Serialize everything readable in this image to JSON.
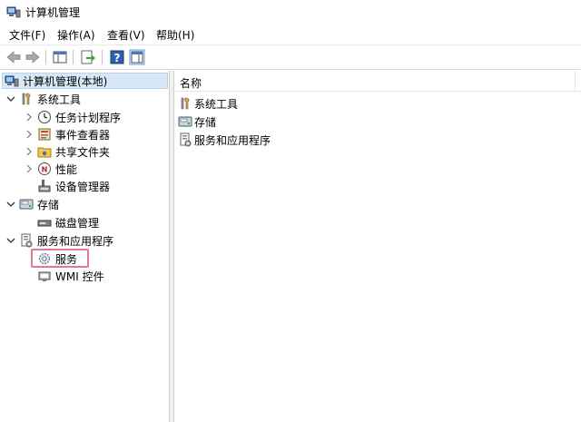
{
  "window": {
    "title": "计算机管理"
  },
  "menu": [
    {
      "label": "文件(F)"
    },
    {
      "label": "操作(A)"
    },
    {
      "label": "查看(V)"
    },
    {
      "label": "帮助(H)"
    }
  ],
  "toolbar": {
    "buttons": [
      "back-icon",
      "forward-icon",
      "show-hide-tree-icon",
      "export-list-icon",
      "help-icon",
      "show-hide-action-pane-icon"
    ]
  },
  "tree": {
    "root": "计算机管理(本地)",
    "system_tools": {
      "label": "系统工具",
      "children": [
        "任务计划程序",
        "事件查看器",
        "共享文件夹",
        "性能",
        "设备管理器"
      ]
    },
    "storage": {
      "label": "存储",
      "children": [
        "磁盘管理"
      ]
    },
    "services_apps": {
      "label": "服务和应用程序",
      "children": [
        "服务",
        "WMI 控件"
      ]
    }
  },
  "list": {
    "column_name": "名称",
    "items": [
      "系统工具",
      "存储",
      "服务和应用程序"
    ]
  },
  "colors": {
    "selection": "#d9e8f7",
    "highlight_box": "#e0789a"
  }
}
